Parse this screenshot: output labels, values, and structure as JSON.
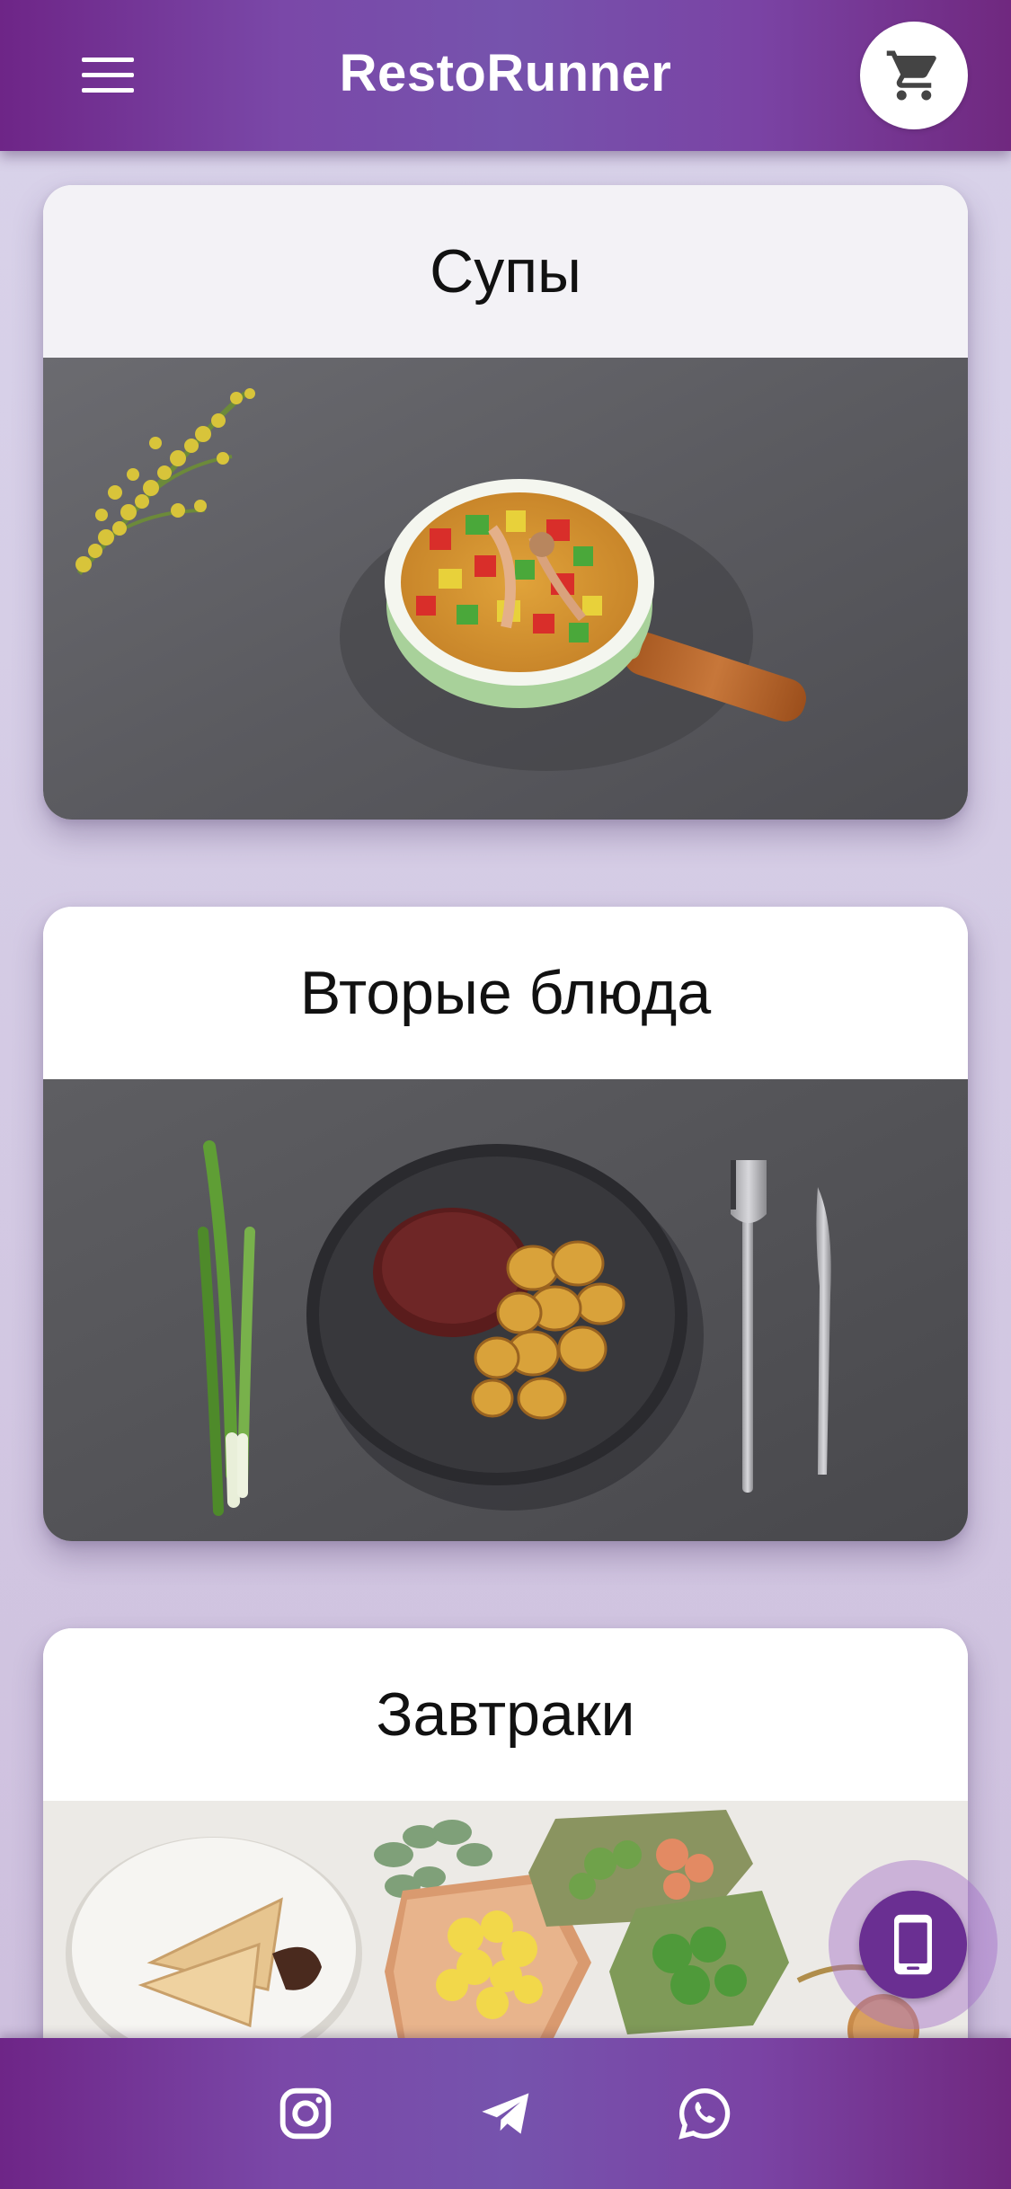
{
  "app_bar": {
    "title": "RestoRunner",
    "menu_icon": "menu-icon",
    "cart_icon": "cart-icon"
  },
  "categories": [
    {
      "title": "Супы",
      "image": "soup-photo"
    },
    {
      "title": "Вторые блюда",
      "image": "main-course-photo"
    },
    {
      "title": "Завтраки",
      "image": "breakfast-photo"
    }
  ],
  "floating_action": {
    "icon": "phone-icon"
  },
  "social_bar": {
    "items": [
      {
        "icon": "instagram-icon"
      },
      {
        "icon": "telegram-icon"
      },
      {
        "icon": "whatsapp-icon"
      }
    ]
  },
  "colors": {
    "brand_purple": "#7653ad",
    "brand_dark": "#6e2587",
    "background": "#d9d3ea"
  }
}
